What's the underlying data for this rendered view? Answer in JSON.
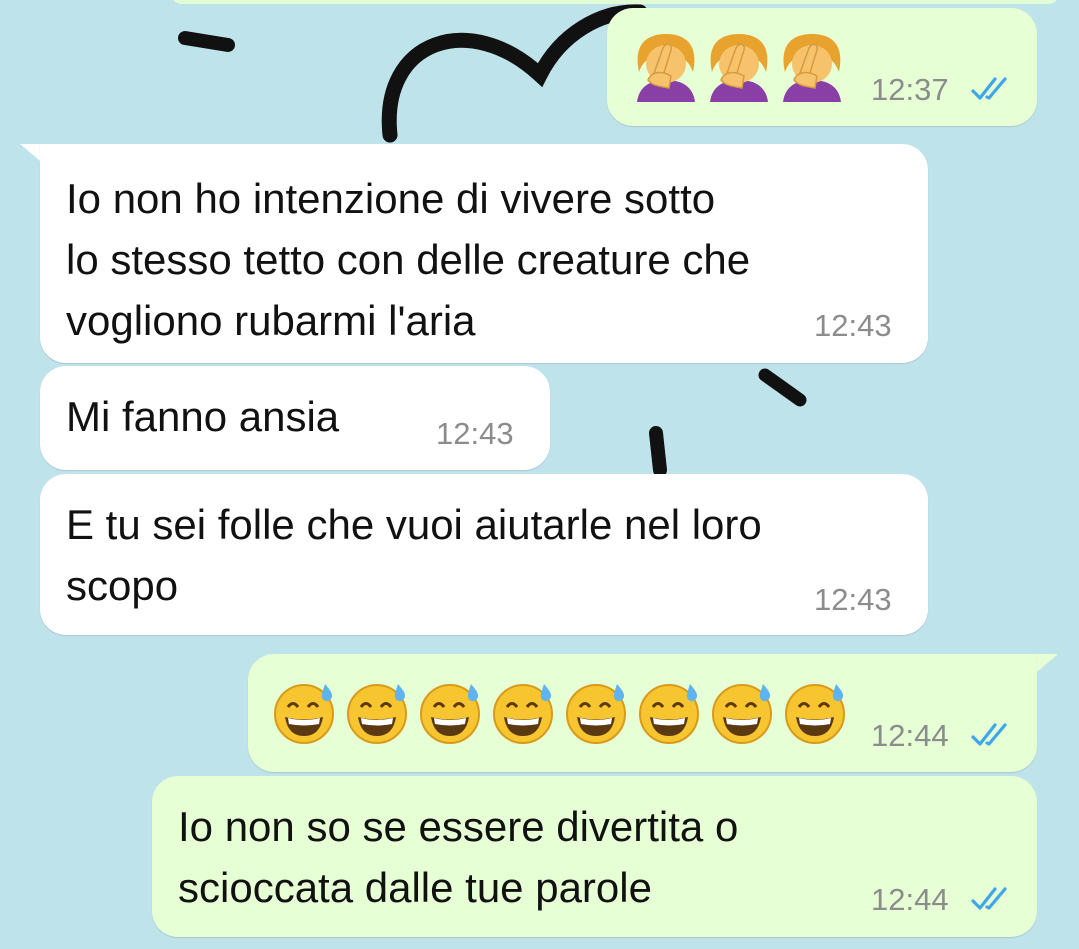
{
  "colors": {
    "wallpaper": "#bfe3ea",
    "incoming_bubble": "#ffffff",
    "outgoing_bubble": "#e6ffd4",
    "read_ticks": "#3ea6ea",
    "timestamp": "#8c8c8c"
  },
  "messages": [
    {
      "direction": "outgoing",
      "content": "facepalm-emoji x3",
      "time": "12:37",
      "status": "read-double-tick"
    },
    {
      "direction": "incoming",
      "text": "Io non ho intenzione di vivere sotto\nlo stesso tetto con delle creature che\nvogliono rubarmi l'aria",
      "time": "12:43"
    },
    {
      "direction": "incoming",
      "text": "Mi fanno ansia",
      "time": "12:43"
    },
    {
      "direction": "incoming",
      "text": "E tu sei folle che vuoi aiutarle nel loro\nscopo",
      "time": "12:43"
    },
    {
      "direction": "outgoing",
      "content": "grinning-sweat-emoji x8",
      "time": "12:44",
      "status": "read-double-tick"
    },
    {
      "direction": "outgoing",
      "text": "Io non so se essere divertita o\nscioccata dalle tue parole",
      "time": "12:44",
      "status": "read-double-tick"
    }
  ]
}
